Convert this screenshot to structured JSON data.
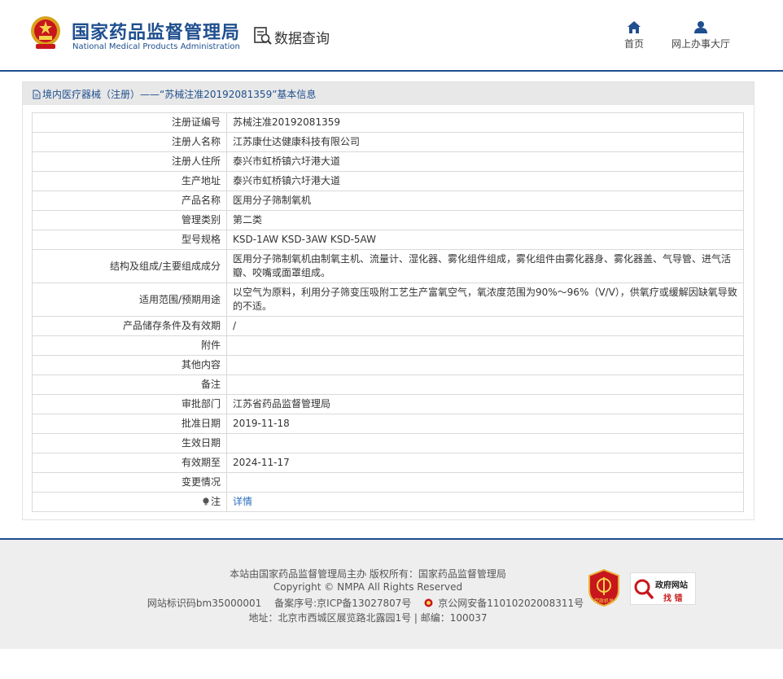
{
  "header": {
    "logo_cn": "国家药品监督管理局",
    "logo_en": "National Medical Products Administration",
    "section_title": "数据查询",
    "nav": [
      {
        "label": "首页",
        "icon": "home-icon"
      },
      {
        "label": "网上办事大厅",
        "icon": "user-icon"
      }
    ],
    "brand_color": "#1f4f8f"
  },
  "breadcrumb": "境内医疗器械（注册）——“苏械注准20192081359”基本信息",
  "rows": [
    {
      "label": "注册证编号",
      "value": "苏械注准20192081359"
    },
    {
      "label": "注册人名称",
      "value": "江苏康仕达健康科技有限公司"
    },
    {
      "label": "注册人住所",
      "value": "泰兴市虹桥镇六圩港大道"
    },
    {
      "label": "生产地址",
      "value": "泰兴市虹桥镇六圩港大道"
    },
    {
      "label": "产品名称",
      "value": "医用分子筛制氧机"
    },
    {
      "label": "管理类别",
      "value": "第二类"
    },
    {
      "label": "型号规格",
      "value": "KSD-1AW KSD-3AW KSD-5AW"
    },
    {
      "label": "结构及组成/主要组成成分",
      "value": "医用分子筛制氧机由制氧主机、流量计、湿化器、雾化组件组成，雾化组件由雾化器身、雾化器盖、气导管、进气活瓣、咬嘴或面罩组成。"
    },
    {
      "label": "适用范围/预期用途",
      "value": "以空气为原料，利用分子筛变压吸附工艺生产富氧空气，氧浓度范围为90%～96%（V/V），供氧疗或缓解因缺氧导致的不适。"
    },
    {
      "label": "产品储存条件及有效期",
      "value": "/"
    },
    {
      "label": "附件",
      "value": ""
    },
    {
      "label": "其他内容",
      "value": ""
    },
    {
      "label": "备注",
      "value": ""
    },
    {
      "label": "审批部门",
      "value": "江苏省药品监督管理局"
    },
    {
      "label": "批准日期",
      "value": "2019-11-18"
    },
    {
      "label": "生效日期",
      "value": ""
    },
    {
      "label": "有效期至",
      "value": "2024-11-17"
    },
    {
      "label": "变更情况",
      "value": ""
    }
  ],
  "note_row": {
    "label": "注",
    "link_text": "详情",
    "icon": "bulb-icon"
  },
  "footer": {
    "line1": "本站由国家药品监督管理局主办 版权所有：国家药品监督管理局",
    "line2": "Copyright © NMPA All Rights Reserved",
    "site_id": "网站标识码bm35000001",
    "icp": "备案序号:京ICP备13027807号",
    "police": "京公网安备11010202008311号",
    "address": "地址：北京市西城区展览路北露园1号 | 邮编：100037",
    "party_badge_text": "党政机关",
    "gov_badge_title": "政府网站",
    "gov_badge_sub": "找 错"
  }
}
